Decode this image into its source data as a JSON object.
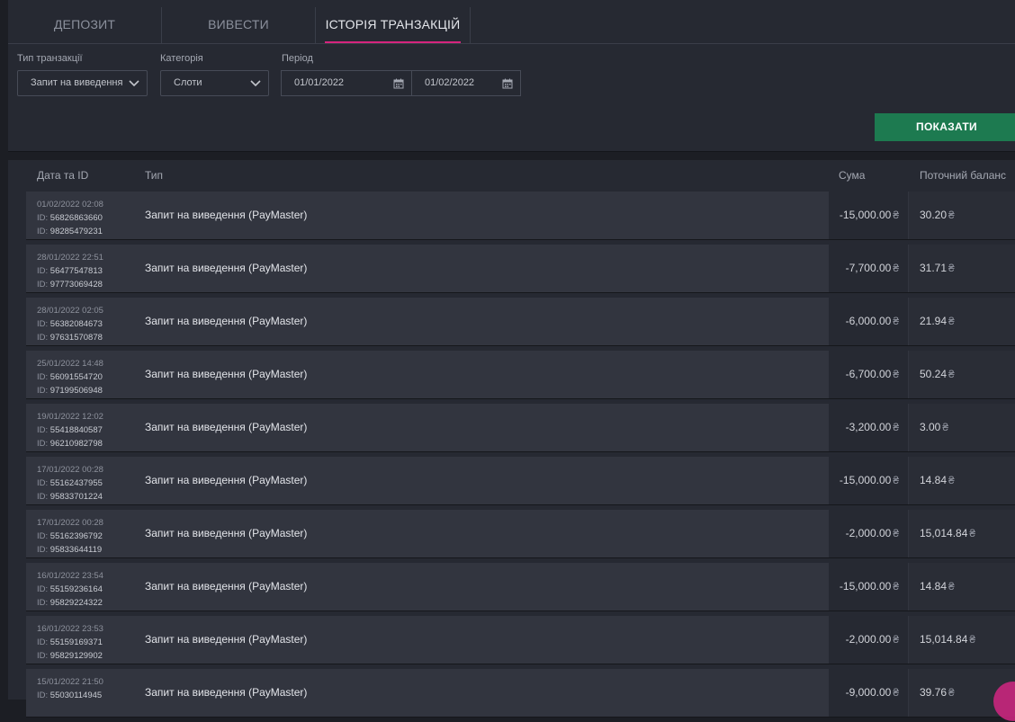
{
  "tabs": [
    {
      "label": "ДЕПОЗИТ"
    },
    {
      "label": "ВИВЕСТИ"
    },
    {
      "label": "ІСТОРІЯ ТРАНЗАКЦІЙ"
    }
  ],
  "filters": {
    "transaction_type": {
      "label": "Тип транзакції",
      "value": "Запит на виведення"
    },
    "category": {
      "label": "Категорія",
      "value": "Слоти"
    },
    "period": {
      "label": "Період",
      "from": "01/01/2022",
      "to": "01/02/2022"
    }
  },
  "show_button": "ПОКАЗАТИ",
  "table": {
    "headers": {
      "date_id": "Дата та ID",
      "type": "Тип",
      "amount": "Сума",
      "balance": "Поточний баланс"
    },
    "id_prefix": "ID:",
    "currency": "₴",
    "rows": [
      {
        "datetime": "01/02/2022 02:08",
        "id1": "56826863660",
        "id2": "98285479231",
        "type": "Запит на виведення (PayMaster)",
        "amount": "-15,000.00",
        "balance": "30.20"
      },
      {
        "datetime": "28/01/2022 22:51",
        "id1": "56477547813",
        "id2": "97773069428",
        "type": "Запит на виведення (PayMaster)",
        "amount": "-7,700.00",
        "balance": "31.71"
      },
      {
        "datetime": "28/01/2022 02:05",
        "id1": "56382084673",
        "id2": "97631570878",
        "type": "Запит на виведення (PayMaster)",
        "amount": "-6,000.00",
        "balance": "21.94"
      },
      {
        "datetime": "25/01/2022 14:48",
        "id1": "56091554720",
        "id2": "97199506948",
        "type": "Запит на виведення (PayMaster)",
        "amount": "-6,700.00",
        "balance": "50.24"
      },
      {
        "datetime": "19/01/2022 12:02",
        "id1": "55418840587",
        "id2": "96210982798",
        "type": "Запит на виведення (PayMaster)",
        "amount": "-3,200.00",
        "balance": "3.00"
      },
      {
        "datetime": "17/01/2022 00:28",
        "id1": "55162437955",
        "id2": "95833701224",
        "type": "Запит на виведення (PayMaster)",
        "amount": "-15,000.00",
        "balance": "14.84"
      },
      {
        "datetime": "17/01/2022 00:28",
        "id1": "55162396792",
        "id2": "95833644119",
        "type": "Запит на виведення (PayMaster)",
        "amount": "-2,000.00",
        "balance": "15,014.84"
      },
      {
        "datetime": "16/01/2022 23:54",
        "id1": "55159236164",
        "id2": "95829224322",
        "type": "Запит на виведення (PayMaster)",
        "amount": "-15,000.00",
        "balance": "14.84"
      },
      {
        "datetime": "16/01/2022 23:53",
        "id1": "55159169371",
        "id2": "95829129902",
        "type": "Запит на виведення (PayMaster)",
        "amount": "-2,000.00",
        "balance": "15,014.84"
      },
      {
        "datetime": "15/01/2022 21:50",
        "id1": "55030114945",
        "id2": "",
        "type": "Запит на виведення (PayMaster)",
        "amount": "-9,000.00",
        "balance": "39.76"
      }
    ]
  }
}
